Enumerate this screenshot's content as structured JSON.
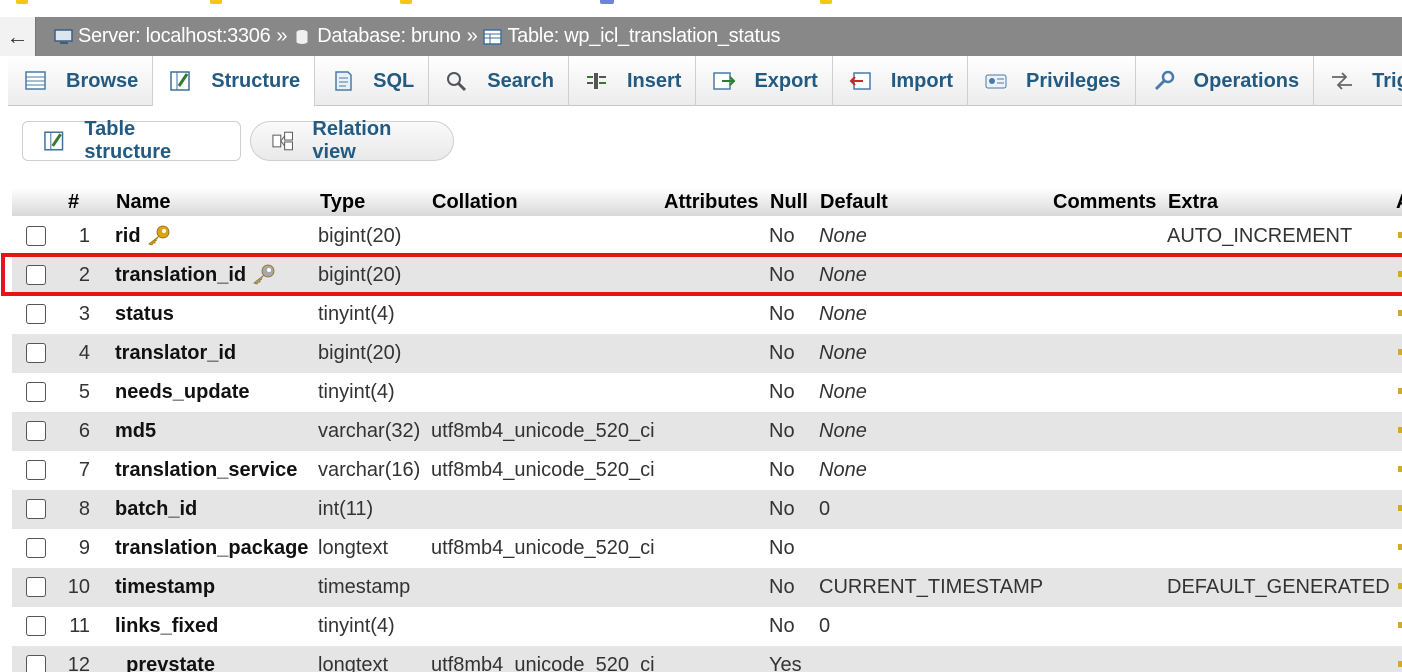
{
  "breadcrumb": {
    "back_arrow": "←",
    "server": "Server: localhost:3306",
    "database": "Database: bruno",
    "table": "Table: wp_icl_translation_status",
    "separator": "»",
    "icons": [
      "server-icon",
      "database-icon",
      "table-icon"
    ]
  },
  "tabs": [
    {
      "label": "Browse",
      "icon": "browse-icon"
    },
    {
      "label": "Structure",
      "icon": "structure-icon",
      "active": true
    },
    {
      "label": "SQL",
      "icon": "sql-icon"
    },
    {
      "label": "Search",
      "icon": "search-icon"
    },
    {
      "label": "Insert",
      "icon": "insert-icon"
    },
    {
      "label": "Export",
      "icon": "export-icon"
    },
    {
      "label": "Import",
      "icon": "import-icon"
    },
    {
      "label": "Privileges",
      "icon": "privileges-icon"
    },
    {
      "label": "Operations",
      "icon": "operations-icon"
    },
    {
      "label": "Trigge",
      "icon": "triggers-icon"
    }
  ],
  "subtabs": {
    "table_structure": "Table structure",
    "relation_view": "Relation view"
  },
  "table": {
    "headers": {
      "num": "#",
      "name": "Name",
      "type": "Type",
      "collation": "Collation",
      "attributes": "Attributes",
      "null": "Null",
      "default": "Default",
      "comments": "Comments",
      "extra": "Extra",
      "action": "A"
    },
    "rows": [
      {
        "num": "1",
        "name": "rid",
        "key": "primary",
        "type": "bigint(20)",
        "collation": "",
        "null": "No",
        "default": "None",
        "default_italic": true,
        "extra": "AUTO_INCREMENT"
      },
      {
        "num": "2",
        "name": "translation_id",
        "key": "index",
        "type": "bigint(20)",
        "collation": "",
        "null": "No",
        "default": "None",
        "default_italic": true,
        "extra": ""
      },
      {
        "num": "3",
        "name": "status",
        "key": "",
        "type": "tinyint(4)",
        "collation": "",
        "null": "No",
        "default": "None",
        "default_italic": true,
        "extra": ""
      },
      {
        "num": "4",
        "name": "translator_id",
        "key": "",
        "type": "bigint(20)",
        "collation": "",
        "null": "No",
        "default": "None",
        "default_italic": true,
        "extra": ""
      },
      {
        "num": "5",
        "name": "needs_update",
        "key": "",
        "type": "tinyint(4)",
        "collation": "",
        "null": "No",
        "default": "None",
        "default_italic": true,
        "extra": ""
      },
      {
        "num": "6",
        "name": "md5",
        "key": "",
        "type": "varchar(32)",
        "collation": "utf8mb4_unicode_520_ci",
        "null": "No",
        "default": "None",
        "default_italic": true,
        "extra": ""
      },
      {
        "num": "7",
        "name": "translation_service",
        "key": "",
        "type": "varchar(16)",
        "collation": "utf8mb4_unicode_520_ci",
        "null": "No",
        "default": "None",
        "default_italic": true,
        "extra": ""
      },
      {
        "num": "8",
        "name": "batch_id",
        "key": "",
        "type": "int(11)",
        "collation": "",
        "null": "No",
        "default": "0",
        "default_italic": false,
        "extra": ""
      },
      {
        "num": "9",
        "name": "translation_package",
        "key": "",
        "type": "longtext",
        "collation": "utf8mb4_unicode_520_ci",
        "null": "No",
        "default": "",
        "default_italic": false,
        "extra": ""
      },
      {
        "num": "10",
        "name": "timestamp",
        "key": "",
        "type": "timestamp",
        "collation": "",
        "null": "No",
        "default": "CURRENT_TIMESTAMP",
        "default_italic": false,
        "extra": "DEFAULT_GENERATED"
      },
      {
        "num": "11",
        "name": "links_fixed",
        "key": "",
        "type": "tinyint(4)",
        "collation": "",
        "null": "No",
        "default": "0",
        "default_italic": false,
        "extra": ""
      },
      {
        "num": "12",
        "name": "_prevstate",
        "key": "",
        "type": "longtext",
        "collation": "utf8mb4_unicode_520_ci",
        "null": "Yes",
        "default": "",
        "default_italic": false,
        "extra": ""
      }
    ]
  },
  "colors": {
    "tab_text": "#235a81",
    "highlight_border": "#e3141a",
    "breadcrumb_bg": "#888888",
    "alt_row_bg": "#e5e5e5",
    "primary_key": "#e0a316",
    "index_key": "#a8a8a8"
  }
}
